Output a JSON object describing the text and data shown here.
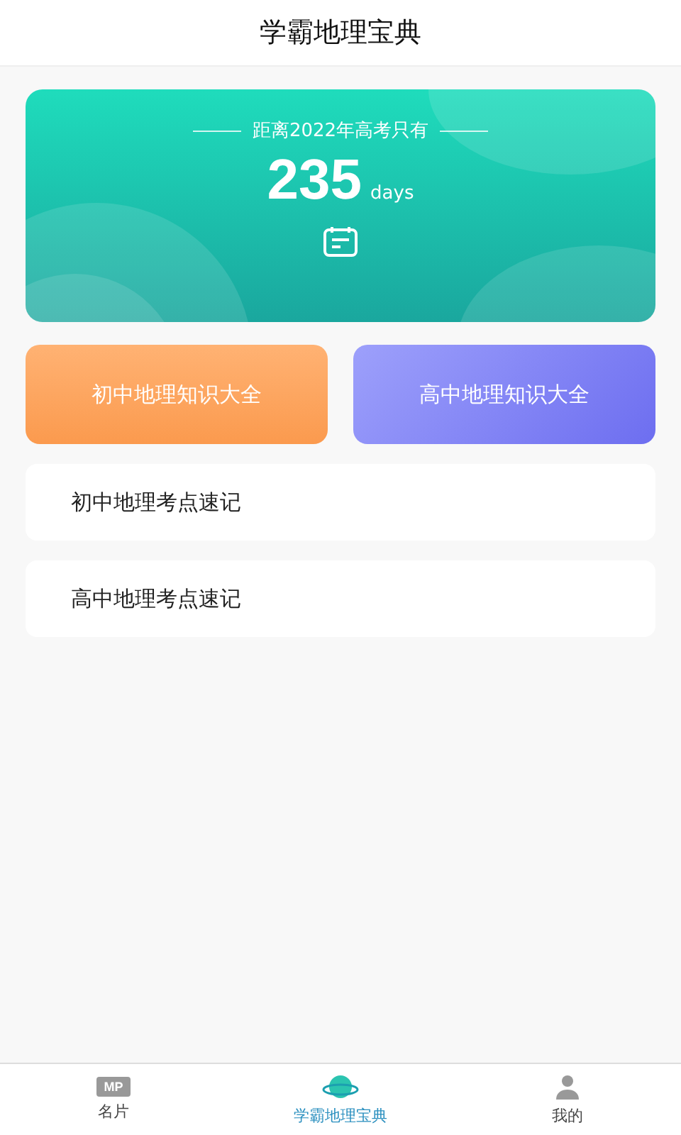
{
  "header": {
    "title": "学霸地理宝典"
  },
  "countdown": {
    "caption": "距离2022年高考只有",
    "number": "235",
    "unit": "days"
  },
  "category_cards": [
    {
      "label": "初中地理知识大全",
      "kind": "orange"
    },
    {
      "label": "高中地理知识大全",
      "kind": "purple"
    }
  ],
  "list_items": [
    {
      "label": "初中地理考点速记"
    },
    {
      "label": "高中地理考点速记"
    }
  ],
  "tab_bar": [
    {
      "label": "名片",
      "kind": "card",
      "badge": "MP",
      "selected": false
    },
    {
      "label": "学霸地理宝典",
      "kind": "planet",
      "selected": true
    },
    {
      "label": "我的",
      "kind": "person",
      "selected": false
    }
  ]
}
